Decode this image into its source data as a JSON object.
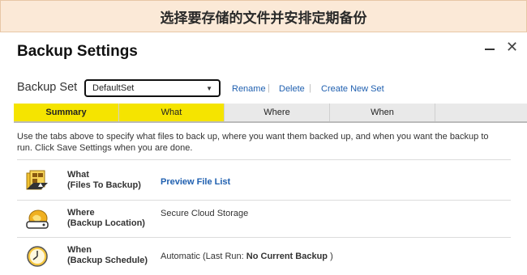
{
  "banner": {
    "text": "选择要存储的文件并安排定期备份"
  },
  "window": {
    "title": "Backup Settings",
    "backup_set_label": "Backup Set",
    "backup_set_value": "DefaultSet",
    "links": {
      "rename": "Rename",
      "delete": "Delete",
      "create": "Create New Set"
    },
    "separator": "|"
  },
  "tabs": [
    {
      "label": "Summary",
      "active": true
    },
    {
      "label": "What",
      "active": true
    },
    {
      "label": "Where",
      "active": false
    },
    {
      "label": "When",
      "active": false
    }
  ],
  "description": "Use the tabs above to specify what files to back up, where you want them backed up, and when you want the backup to run. Click Save Settings when you are done.",
  "rows": [
    {
      "title": "What",
      "subtitle": "(Files To Backup)",
      "icon": "folder-files-icon",
      "value": "Preview File List"
    },
    {
      "title": "Where",
      "subtitle": "(Backup Location)",
      "icon": "cloud-drive-icon",
      "value": "Secure Cloud Storage"
    },
    {
      "title": "When",
      "subtitle": "(Backup Schedule)",
      "icon": "clock-icon",
      "value_prefix": "Automatic (Last Run: ",
      "value_bold": "No Current Backup",
      "value_suffix": " )"
    }
  ],
  "colors": {
    "banner_bg": "#fbe9d7",
    "tab_active": "#f5e400",
    "link": "#2060b0"
  }
}
